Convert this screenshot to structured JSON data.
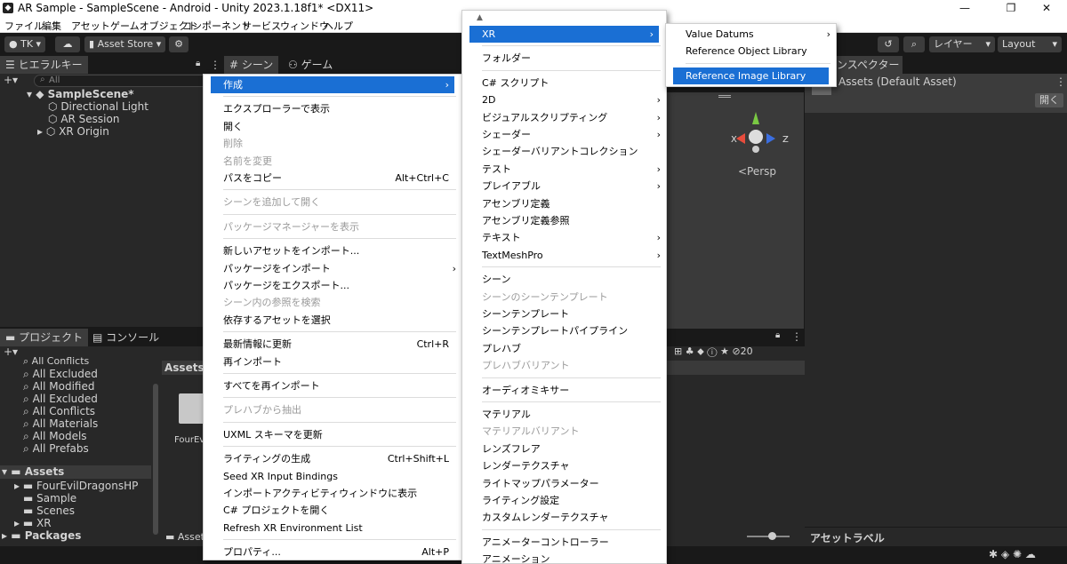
{
  "window": {
    "title": "AR Sample - SampleScene - Android - Unity 2023.1.18f1* <DX11>"
  },
  "menubar": [
    "ファイル",
    "編集",
    "アセット",
    "ゲームオブジェクト",
    "コンポーネント",
    "サービス",
    "ウィンドウ",
    "ヘルプ"
  ],
  "toolbar": {
    "account": "TK",
    "asset_store": "Asset Store",
    "layers": "レイヤー",
    "layout": "Layout"
  },
  "hierarchy": {
    "tab": "ヒエラルキー",
    "search_placeholder": "All",
    "items": [
      "SampleScene*",
      "Directional Light",
      "AR Session",
      "XR Origin"
    ]
  },
  "scene_tabs": {
    "scene": "シーン",
    "game": "ゲーム"
  },
  "scene_view": {
    "persp": "<Persp",
    "x": "X",
    "z": "Z"
  },
  "inspector": {
    "tab": "インスペクター",
    "asset": "Assets (Default Asset)",
    "open": "開く",
    "asset_label": "アセットラベル"
  },
  "project": {
    "tab_project": "プロジェクト",
    "tab_console": "コンソール",
    "favorites": [
      "All Conflicts",
      "All Excluded",
      "All Modified",
      "All Excluded",
      "All Conflicts",
      "All Materials",
      "All Models",
      "All Prefabs"
    ],
    "assets_root": "Assets",
    "asset_folders": [
      "FourEvilDragonsHP",
      "Sample",
      "Scenes",
      "XR"
    ],
    "packages": "Packages",
    "breadcrumb": "Assets",
    "folder_item": "FourEvil",
    "bottom_path": "Asset",
    "hidden_count": "20"
  },
  "context_menu": {
    "items": [
      {
        "label": "作成",
        "arrow": "›",
        "highlight": true
      },
      {
        "sep": true
      },
      {
        "label": "エクスプローラーで表示"
      },
      {
        "label": "開く"
      },
      {
        "label": "削除",
        "disabled": true
      },
      {
        "label": "名前を変更",
        "disabled": true
      },
      {
        "label": "パスをコピー",
        "shortcut": "Alt+Ctrl+C"
      },
      {
        "sep": true
      },
      {
        "label": "シーンを追加して開く",
        "disabled": true
      },
      {
        "sep": true
      },
      {
        "label": "パッケージマネージャーを表示",
        "disabled": true
      },
      {
        "sep": true
      },
      {
        "label": "新しいアセットをインポート..."
      },
      {
        "label": "パッケージをインポート",
        "arrow": "›"
      },
      {
        "label": "パッケージをエクスポート..."
      },
      {
        "label": "シーン内の参照を検索",
        "disabled": true
      },
      {
        "label": "依存するアセットを選択"
      },
      {
        "sep": true
      },
      {
        "label": "最新情報に更新",
        "shortcut": "Ctrl+R"
      },
      {
        "label": "再インポート"
      },
      {
        "sep": true
      },
      {
        "label": "すべてを再インポート"
      },
      {
        "sep": true
      },
      {
        "label": "プレハブから抽出",
        "disabled": true
      },
      {
        "sep": true
      },
      {
        "label": "UXML スキーマを更新"
      },
      {
        "sep": true
      },
      {
        "label": "ライティングの生成",
        "shortcut": "Ctrl+Shift+L"
      },
      {
        "label": "Seed XR Input Bindings"
      },
      {
        "label": "インポートアクティビティウィンドウに表示"
      },
      {
        "label": "C# プロジェクトを開く"
      },
      {
        "label": "Refresh XR Environment List"
      },
      {
        "sep": true
      },
      {
        "label": "プロパティ...",
        "shortcut": "Alt+P"
      }
    ]
  },
  "create_menu": {
    "items": [
      {
        "label": "XR",
        "arrow": "›",
        "highlight": true
      },
      {
        "sep": true
      },
      {
        "label": "フォルダー"
      },
      {
        "sep": true
      },
      {
        "label": "C# スクリプト"
      },
      {
        "label": "2D",
        "arrow": "›"
      },
      {
        "label": "ビジュアルスクリプティング",
        "arrow": "›"
      },
      {
        "label": "シェーダー",
        "arrow": "›"
      },
      {
        "label": "シェーダーバリアントコレクション"
      },
      {
        "label": "テスト",
        "arrow": "›"
      },
      {
        "label": "プレイアブル",
        "arrow": "›"
      },
      {
        "label": "アセンブリ定義"
      },
      {
        "label": "アセンブリ定義参照"
      },
      {
        "label": "テキスト",
        "arrow": "›"
      },
      {
        "label": "TextMeshPro",
        "arrow": "›"
      },
      {
        "sep": true
      },
      {
        "label": "シーン"
      },
      {
        "label": "シーンのシーンテンプレート",
        "disabled": true
      },
      {
        "label": "シーンテンプレート"
      },
      {
        "label": "シーンテンプレートパイプライン"
      },
      {
        "label": "プレハブ"
      },
      {
        "label": "プレハブバリアント",
        "disabled": true
      },
      {
        "sep": true
      },
      {
        "label": "オーディオミキサー"
      },
      {
        "sep": true
      },
      {
        "label": "マテリアル"
      },
      {
        "label": "マテリアルバリアント",
        "disabled": true
      },
      {
        "label": "レンズフレア"
      },
      {
        "label": "レンダーテクスチャ"
      },
      {
        "label": "ライトマップパラメーター"
      },
      {
        "label": "ライティング設定"
      },
      {
        "label": "カスタムレンダーテクスチャ"
      },
      {
        "sep": true
      },
      {
        "label": "アニメーターコントローラー"
      },
      {
        "label": "アニメーション"
      }
    ]
  },
  "xr_menu": {
    "items": [
      {
        "label": "Value Datums",
        "arrow": "›"
      },
      {
        "label": "Reference Object Library"
      },
      {
        "sep": true
      },
      {
        "label": "Reference Image Library",
        "highlight": true
      }
    ]
  }
}
